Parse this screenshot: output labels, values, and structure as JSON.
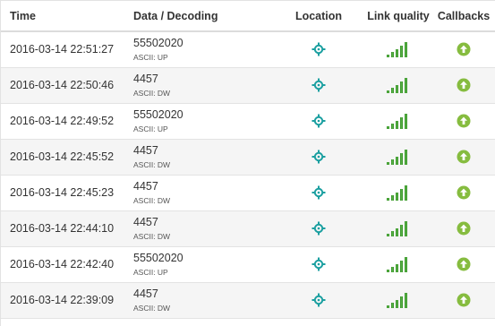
{
  "header": {
    "time": "Time",
    "data": "Data / Decoding",
    "location": "Location",
    "link_quality": "Link quality",
    "callbacks": "Callbacks"
  },
  "colors": {
    "location_icon": "#1a9fa0",
    "signal_green": "#3b9a2e",
    "callback_green": "#86bc3f"
  },
  "icons": {
    "location": "crosshair-icon",
    "link_quality": "signal-bars-icon",
    "callbacks": "arrow-up-circle-icon"
  },
  "rows": [
    {
      "time": "2016-03-14 22:51:27",
      "payload": "55502020",
      "decoding": "ASCII: UP"
    },
    {
      "time": "2016-03-14 22:50:46",
      "payload": "4457",
      "decoding": "ASCII: DW"
    },
    {
      "time": "2016-03-14 22:49:52",
      "payload": "55502020",
      "decoding": "ASCII: UP"
    },
    {
      "time": "2016-03-14 22:45:52",
      "payload": "4457",
      "decoding": "ASCII: DW"
    },
    {
      "time": "2016-03-14 22:45:23",
      "payload": "4457",
      "decoding": "ASCII: DW"
    },
    {
      "time": "2016-03-14 22:44:10",
      "payload": "4457",
      "decoding": "ASCII: DW"
    },
    {
      "time": "2016-03-14 22:42:40",
      "payload": "55502020",
      "decoding": "ASCII: UP"
    },
    {
      "time": "2016-03-14 22:39:09",
      "payload": "4457",
      "decoding": "ASCII: DW"
    }
  ]
}
